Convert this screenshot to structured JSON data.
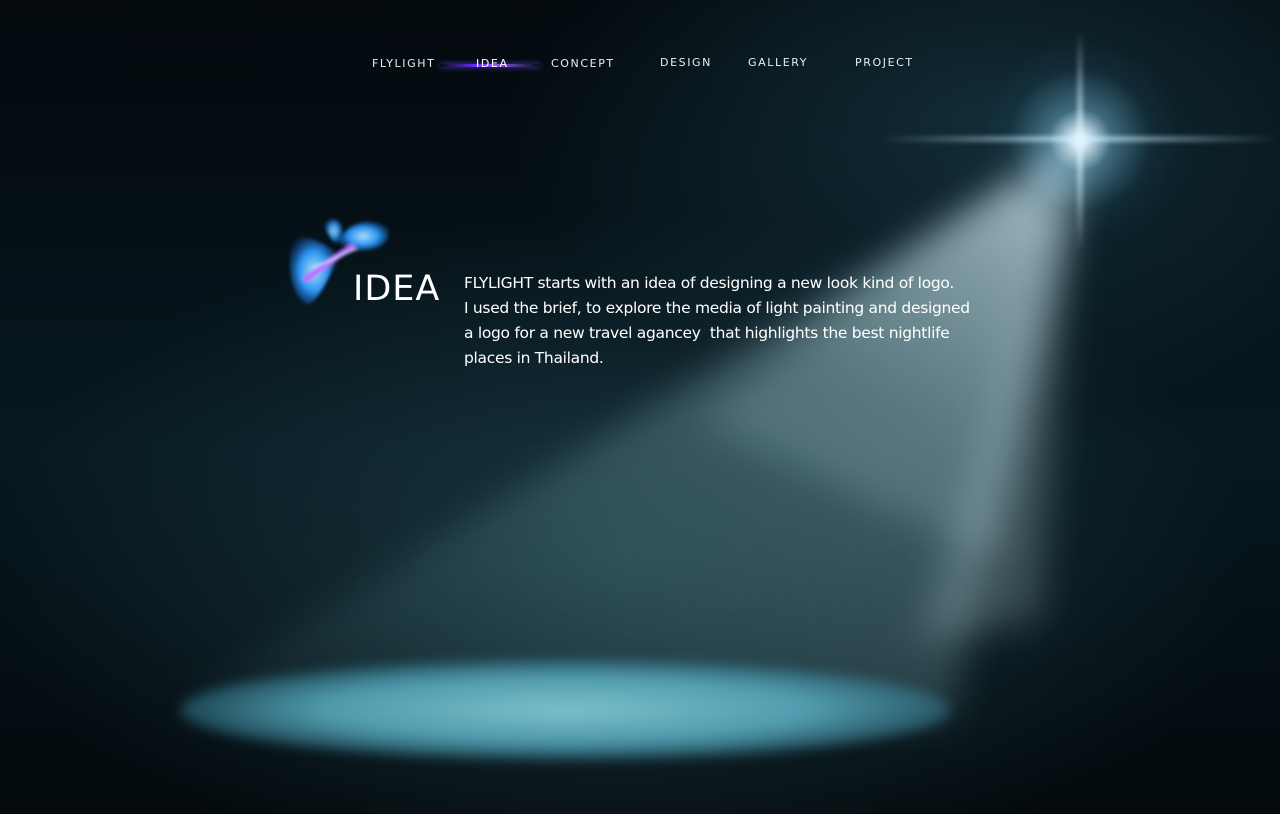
{
  "nav": {
    "items": [
      {
        "label": "FLYLIGHT"
      },
      {
        "label": "IDEA",
        "active": true
      },
      {
        "label": "CONCEPT"
      },
      {
        "label": "DESIGN"
      },
      {
        "label": "GALLERY"
      },
      {
        "label": "PROJECT"
      }
    ],
    "active_color": "#6a2bff"
  },
  "logo": {
    "icon": "butterfly-light-logo-icon"
  },
  "section": {
    "title": "IDEA",
    "lines": [
      "FLYLIGHT starts with an idea of designing a new look kind of logo.",
      "I used the brief, to explore the media of light painting and designed",
      "a logo for a new travel agancey  that highlights the best nightlife",
      "places in Thailand."
    ]
  },
  "colors": {
    "background": "#041016",
    "text": "#ffffff",
    "spotlight": "#82c8d2"
  }
}
